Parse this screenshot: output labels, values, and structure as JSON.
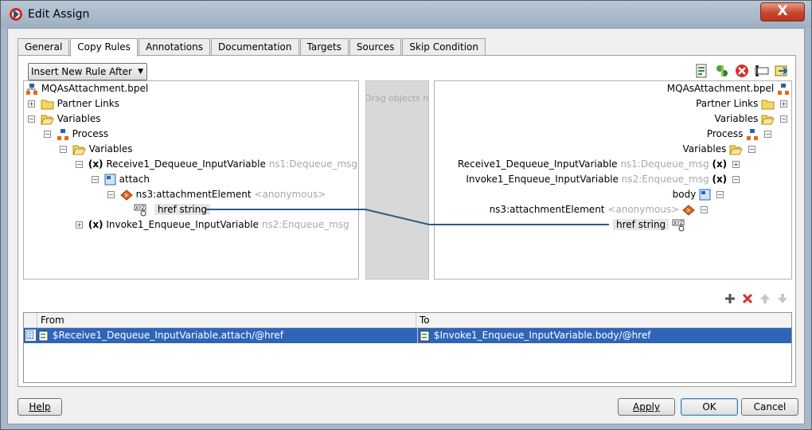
{
  "window": {
    "title": "Edit Assign",
    "close_label": "X"
  },
  "tabs": [
    "General",
    "Copy Rules",
    "Annotations",
    "Documentation",
    "Targets",
    "Sources",
    "Skip Condition"
  ],
  "active_tab": "Copy Rules",
  "toolbar": {
    "insert_dropdown": "Insert New Rule After",
    "icons": [
      "expression-builder-icon",
      "xml-fragment-icon",
      "delete-icon",
      "literal-icon",
      "append-icon"
    ]
  },
  "middle": {
    "placeholder": "Drag objects here"
  },
  "left_tree": {
    "root": "MQAsAttachment.bpel",
    "partner_links": "Partner Links",
    "variables": "Variables",
    "process": "Process",
    "process_variables": "Variables",
    "receive_var": "Receive1_Dequeue_InputVariable",
    "receive_var_type": "ns1:Dequeue_msg",
    "attach": "attach",
    "attachment_element": "ns3:attachmentElement",
    "attachment_element_type": "<anonymous>",
    "href": "href string",
    "invoke_var": "Invoke1_Enqueue_InputVariable",
    "invoke_var_type": "ns2:Enqueue_msg"
  },
  "right_tree": {
    "root": "MQAsAttachment.bpel",
    "partner_links": "Partner Links",
    "variables": "Variables",
    "process": "Process",
    "process_variables": "Variables",
    "receive_var": "Receive1_Dequeue_InputVariable",
    "receive_var_type": "ns1:Dequeue_msg",
    "invoke_var": "Invoke1_Enqueue_InputVariable",
    "invoke_var_type": "ns2:Enqueue_msg",
    "body": "body",
    "attachment_element": "ns3:attachmentElement",
    "attachment_element_type": "<anonymous>",
    "href": "href string"
  },
  "rules_table": {
    "headers": {
      "from": "From",
      "to": "To"
    },
    "rows": [
      {
        "from": "$Receive1_Dequeue_InputVariable.attach/@href",
        "to": "$Invoke1_Enqueue_InputVariable.body/@href"
      }
    ]
  },
  "footer": {
    "help": "Help",
    "apply": "Apply",
    "ok": "OK",
    "cancel": "Cancel"
  },
  "colors": {
    "selection": "#2f65b9",
    "mapping_line": "#2b5a86",
    "titlebar": "#a9b8c9"
  }
}
